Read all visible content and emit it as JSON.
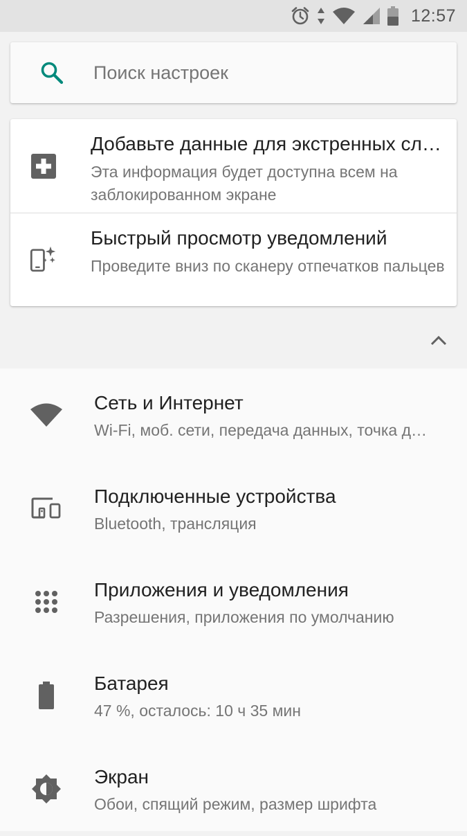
{
  "status_bar": {
    "time": "12:57",
    "icons": [
      "alarm-icon",
      "data-arrows-icon",
      "wifi-icon",
      "signal-icon",
      "battery-icon"
    ]
  },
  "search": {
    "placeholder": "Поиск настроек",
    "icon": "search-icon",
    "accent_color": "#00897b"
  },
  "suggestions": [
    {
      "icon": "medical-plus-icon",
      "title": "Добавьте данные для экстренных случаев",
      "subtitle": "Эта информация будет доступна всем на заблокированном экране"
    },
    {
      "icon": "phone-sparkle-icon",
      "title": "Быстрый просмотр уведомлений",
      "subtitle": "Проведите вниз по сканеру отпечатков пальцев"
    }
  ],
  "collapse_icon": "chevron-up-icon",
  "settings": [
    {
      "icon": "wifi-icon",
      "title": "Сеть и Интернет",
      "subtitle": "Wi-Fi, моб. сети, передача данных, точка доступа"
    },
    {
      "icon": "connected-devices-icon",
      "title": "Подключенные устройства",
      "subtitle": "Bluetooth, трансляция"
    },
    {
      "icon": "apps-grid-icon",
      "title": "Приложения и уведомления",
      "subtitle": "Разрешения, приложения по умолчанию"
    },
    {
      "icon": "battery-icon",
      "title": "Батарея",
      "subtitle": "47 %, осталось: 10 ч 35 мин"
    },
    {
      "icon": "brightness-icon",
      "title": "Экран",
      "subtitle": "Обои, спящий режим, размер шрифта"
    }
  ]
}
